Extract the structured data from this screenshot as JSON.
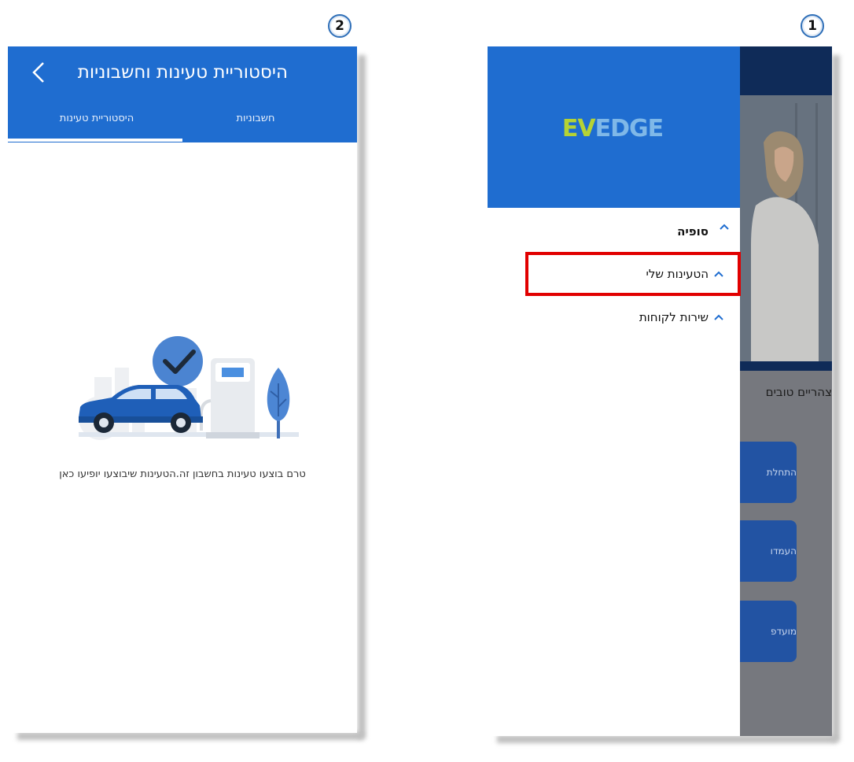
{
  "step_badges": {
    "left": "2",
    "right": "1"
  },
  "screen2": {
    "title": "היסטוריית טעינות וחשבוניות",
    "back_icon": "chevron-left-icon",
    "tabs": [
      {
        "label": "חשבוניות",
        "active": false
      },
      {
        "label": "היסטוריית טעינות",
        "active": true
      }
    ],
    "empty_state": {
      "icon": "car-charging-checkmark-illustration",
      "message": "טרם בוצעו טעינות בחשבון זה.הטעינות שיבוצעו יופיעו כאן"
    }
  },
  "screen1": {
    "drawer": {
      "logo_text": "EVEDGE",
      "user_name": "סופיה",
      "menu_items": [
        {
          "label": "הטעינות שלי",
          "highlighted": true
        },
        {
          "label": "שירות לקוחות",
          "highlighted": false
        }
      ]
    },
    "background": {
      "greeting": "צהריים טובים",
      "buttons": [
        "התחלת",
        "העמדו",
        "מועדפ"
      ]
    }
  },
  "colors": {
    "brand_blue": "#1f6dd0",
    "highlight_red": "#e10000",
    "logo_green": "#b5d334",
    "logo_blue": "#1d5fb5"
  }
}
